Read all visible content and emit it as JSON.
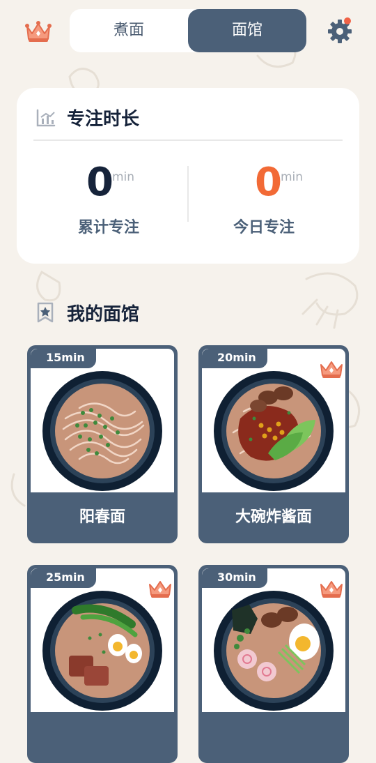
{
  "topbar": {
    "tabs": [
      {
        "label": "煮面",
        "active": false
      },
      {
        "label": "面馆",
        "active": true
      }
    ],
    "notification_dot": true
  },
  "focus_stats": {
    "title": "专注时长",
    "total": {
      "value": "0",
      "unit": "min",
      "label": "累计专注"
    },
    "today": {
      "value": "0",
      "unit": "min",
      "label": "今日专注"
    }
  },
  "shop": {
    "title": "我的面馆",
    "items": [
      {
        "time": "15min",
        "name": "阳春面",
        "premium": false
      },
      {
        "time": "20min",
        "name": "大碗炸酱面",
        "premium": true
      },
      {
        "time": "25min",
        "name": "",
        "premium": true
      },
      {
        "time": "30min",
        "name": "",
        "premium": true
      }
    ]
  },
  "colors": {
    "background": "#f6f2ec",
    "accent": "#4b6078",
    "today_highlight": "#f26a36",
    "notification": "#f06246",
    "crown": "#f08a6e"
  },
  "icons": [
    "crown-icon",
    "gear-icon",
    "chart-icon",
    "bookmark-star-icon"
  ]
}
